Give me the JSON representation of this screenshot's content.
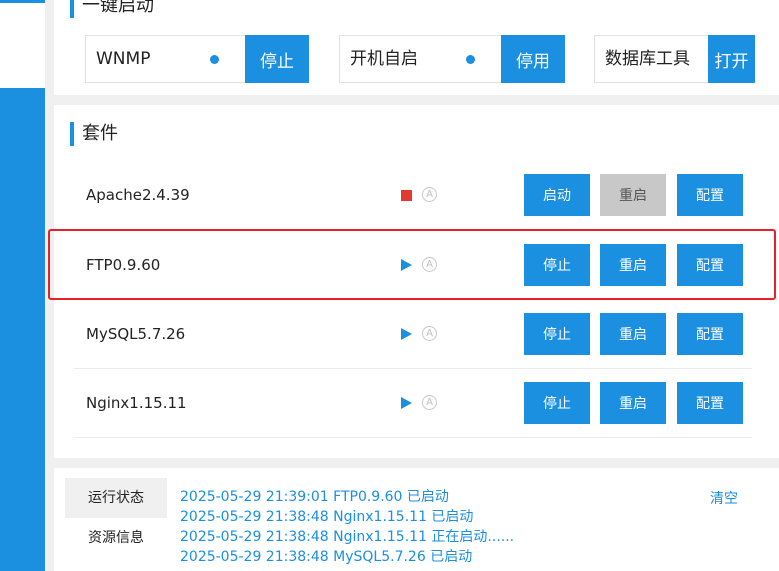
{
  "top_card": {
    "title": "一键启动",
    "quick_items": [
      {
        "label": "WNMP",
        "button": "停止"
      },
      {
        "label": "开机自启",
        "button": "停用"
      },
      {
        "label": "数据库工具",
        "button": "打开"
      }
    ]
  },
  "suite": {
    "title": "套件",
    "auto_symbol": "A",
    "rows": [
      {
        "name": "Apache2.4.39",
        "status": "stopped",
        "btn1": "启动",
        "btn2": "重启",
        "btn3": "配置"
      },
      {
        "name": "FTP0.9.60",
        "status": "running",
        "btn1": "停止",
        "btn2": "重启",
        "btn3": "配置"
      },
      {
        "name": "MySQL5.7.26",
        "status": "running",
        "btn1": "停止",
        "btn2": "重启",
        "btn3": "配置"
      },
      {
        "name": "Nginx1.15.11",
        "status": "running",
        "btn1": "停止",
        "btn2": "重启",
        "btn3": "配置"
      }
    ]
  },
  "log": {
    "tabs": [
      "运行状态",
      "资源信息"
    ],
    "clear": "清空",
    "lines": [
      "2025-05-29 21:39:01 FTP0.9.60 已启动",
      "2025-05-29 21:38:48 Nginx1.15.11 已启动",
      "2025-05-29 21:38:48 Nginx1.15.11 正在启动......",
      "2025-05-29 21:38:48 MySQL5.7.26 已启动"
    ]
  },
  "colors": {
    "accent": "#1b8fe0",
    "stopped": "#e23a30",
    "highlight": "#e8202a"
  }
}
